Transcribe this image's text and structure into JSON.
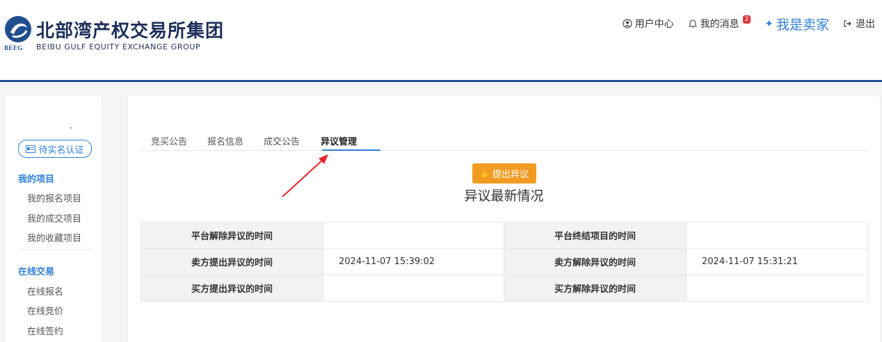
{
  "brand": {
    "abbr": "BEEG",
    "name_cn": "北部湾产权交易所集团",
    "name_en": "BEIBU GULF EQUITY EXCHANGE GROUP",
    "color": "#1f4f8f"
  },
  "topnav": {
    "user_center": "用户中心",
    "messages": "我的消息",
    "message_count": "2",
    "seller": "我是卖家",
    "logout": "退出"
  },
  "sidebar": {
    "verify_label": "待实名认证",
    "sections": [
      {
        "title": "我的项目",
        "items": [
          "我的报名项目",
          "我的成交项目",
          "我的收藏项目"
        ]
      },
      {
        "title": "在线交易",
        "items": [
          "在线报名",
          "在线竞价",
          "在线签约"
        ]
      }
    ]
  },
  "tabs": [
    {
      "label": "竞买公告",
      "active": false
    },
    {
      "label": "报名信息",
      "active": false
    },
    {
      "label": "成交公告",
      "active": false
    },
    {
      "label": "异议管理",
      "active": true
    }
  ],
  "raise_button": "提出异议",
  "section_title": "异议最新情况",
  "table": {
    "rows": [
      {
        "l1": "平台解除异议的时间",
        "v1": "",
        "l2": "平台终结项目的时间",
        "v2": ""
      },
      {
        "l1": "卖方提出异议的时间",
        "v1": "2024-11-07 15:39:02",
        "l2": "卖方解除异议的时间",
        "v2": "2024-11-07 15:31:21"
      },
      {
        "l1": "买方提出异议的时间",
        "v1": "",
        "l2": "买方解除异议的时间",
        "v2": ""
      }
    ]
  },
  "colors": {
    "accent": "#2f7fd8",
    "button_orange": "#f29b22",
    "badge_red": "#e0343a",
    "annotation_arrow": "#e3262b"
  }
}
